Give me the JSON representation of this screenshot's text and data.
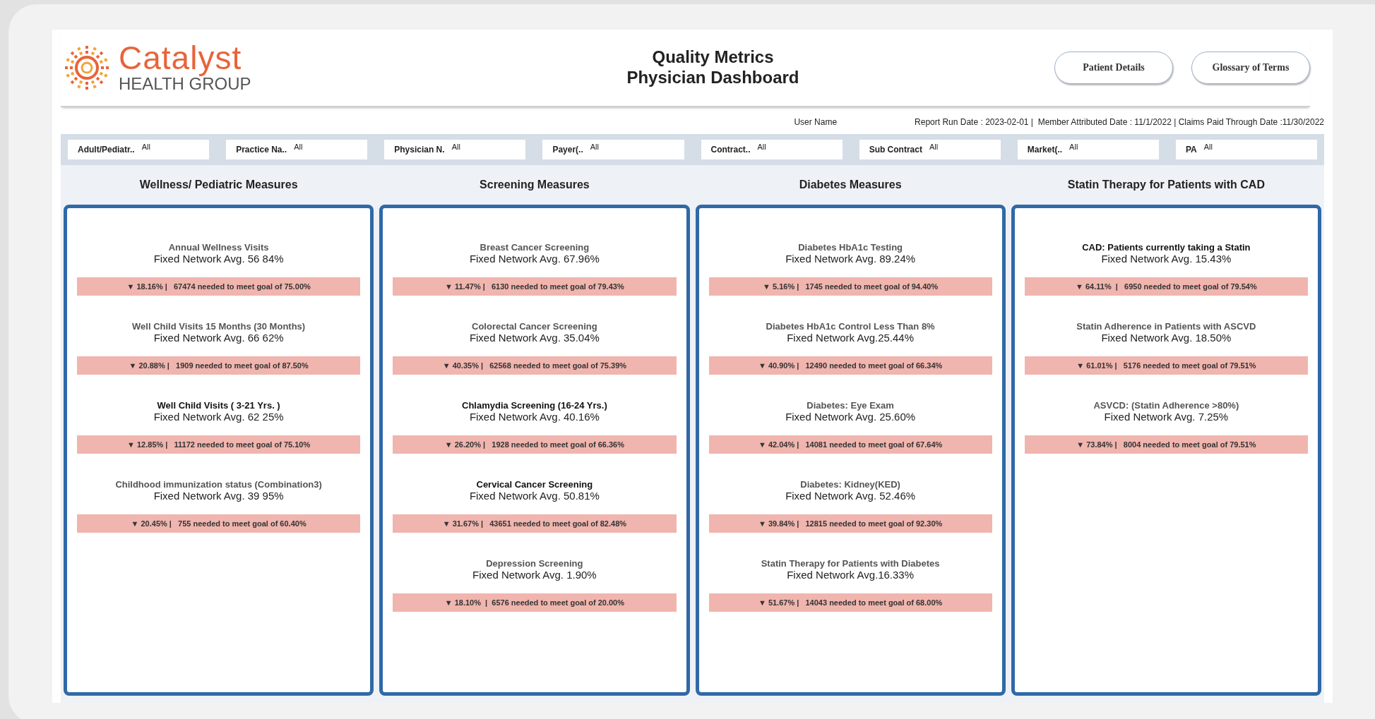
{
  "brand": {
    "name": "Catalyst",
    "tagline": "HEALTH GROUP"
  },
  "title": {
    "line1": "Quality Metrics",
    "line2": "Physician Dashboard"
  },
  "buttons": [
    "Patient Details",
    "Glossary of Terms"
  ],
  "info_bar": {
    "user": "User Name",
    "report": "Report Run Date : 2023-02-01 |  Member Attributed Date : 11/1/2022 | Claims Paid Through Date :11/30/2022"
  },
  "filters": [
    {
      "label": "Adult/Pediatr..",
      "value": "All"
    },
    {
      "label": "Practice Na..",
      "value": "All"
    },
    {
      "label": "Physician N.",
      "value": "All"
    },
    {
      "label": "Payer(..",
      "value": "All"
    },
    {
      "label": "Contract..",
      "value": "All"
    },
    {
      "label": "Sub Contract",
      "value": "All"
    },
    {
      "label": "Market(..",
      "value": "All"
    },
    {
      "label": "PA",
      "value": "All"
    }
  ],
  "sections": [
    {
      "title": "Wellness/ Pediatric Measures",
      "metrics": [
        {
          "name": "Annual Wellness Visits",
          "avg": "Fixed Network Avg. 56 84%",
          "status": "▼ 18.16% |   67474 needed to meet goal of 75.00%",
          "emphasized": false
        },
        {
          "name": "Well Child Visits 15 Months (30 Months)",
          "avg": "Fixed Network Avg. 66 62%",
          "status": "▼ 20.88% |   1909 needed to meet goal of 87.50%",
          "emphasized": false
        },
        {
          "name": "Well Child Visits ( 3-21 Yrs. )",
          "avg": "Fixed Network Avg. 62 25%",
          "status": "▼ 12.85% |   11172 needed to meet goal of 75.10%",
          "emphasized": true
        },
        {
          "name": "Childhood immunization status (Combination3)",
          "avg": "Fixed Network Avg. 39 95%",
          "status": "▼ 20.45% |   755 needed to meet goal of 60.40%",
          "emphasized": false
        }
      ]
    },
    {
      "title": "Screening Measures",
      "metrics": [
        {
          "name": "Breast Cancer Screening",
          "avg": "Fixed Network Avg. 67.96%",
          "status": "▼ 11.47% |   6130 needed to meet goal of 79.43%",
          "emphasized": false
        },
        {
          "name": "Colorectal Cancer Screening",
          "avg": "Fixed Network Avg. 35.04%",
          "status": "▼ 40.35% |   62568 needed to meet goal of 75.39%",
          "emphasized": false
        },
        {
          "name": "Chlamydia Screening (16-24 Yrs.)",
          "avg": "Fixed Network Avg. 40.16%",
          "status": "▼ 26.20% |   1928 needed to meet goal of 66.36%",
          "emphasized": true
        },
        {
          "name": "Cervical Cancer Screening",
          "avg": "Fixed Network Avg. 50.81%",
          "status": "▼ 31.67% |   43651 needed to meet goal of 82.48%",
          "emphasized": true
        },
        {
          "name": "Depression Screening",
          "avg": "Fixed Network Avg.  1.90%",
          "status": "▼ 18.10%  |  6576 needed to meet goal of 20.00%",
          "emphasized": false
        }
      ]
    },
    {
      "title": "Diabetes Measures",
      "metrics": [
        {
          "name": "Diabetes HbA1c Testing",
          "avg": "Fixed Network Avg. 89.24%",
          "status": "▼ 5.16% |   1745 needed to meet goal of 94.40%",
          "emphasized": false
        },
        {
          "name": "Diabetes HbA1c Control Less Than 8%",
          "avg": "Fixed Network Avg.25.44%",
          "status": "▼ 40.90% |   12490 needed to meet goal of 66.34%",
          "emphasized": false
        },
        {
          "name": "Diabetes: Eye Exam",
          "avg": "Fixed Network Avg. 25.60%",
          "status": "▼ 42.04% |   14081 needed to meet goal of 67.64%",
          "emphasized": false
        },
        {
          "name": "Diabetes: Kidney(KED)",
          "avg": "Fixed Network Avg. 52.46%",
          "status": "▼ 39.84% |   12815 needed to meet goal of 92.30%",
          "emphasized": false
        },
        {
          "name": "Statin Therapy for Patients with Diabetes",
          "avg": "Fixed Network Avg.16.33%",
          "status": "▼ 51.67% |   14043 needed to meet goal of 68.00%",
          "emphasized": false
        }
      ]
    },
    {
      "title": "Statin Therapy for Patients with CAD",
      "metrics": [
        {
          "name": "CAD: Patients currently taking a Statin",
          "avg": "Fixed Network Avg.  15.43%",
          "status": "▼ 64.11%  |   6950 needed to meet goal of 79.54%",
          "emphasized": true
        },
        {
          "name": "Statin Adherence in Patients with ASCVD",
          "avg": "Fixed Network Avg.  18.50%",
          "status": "▼ 61.01% |   5176 needed to meet goal of 79.51%",
          "emphasized": false
        },
        {
          "name": "ASVCD:  (Statin Adherence >80%)",
          "avg": "Fixed Network Avg.  7.25%",
          "status": "▼ 73.84% |   8004 needed to meet goal of 79.51%",
          "emphasized": false
        }
      ]
    }
  ]
}
